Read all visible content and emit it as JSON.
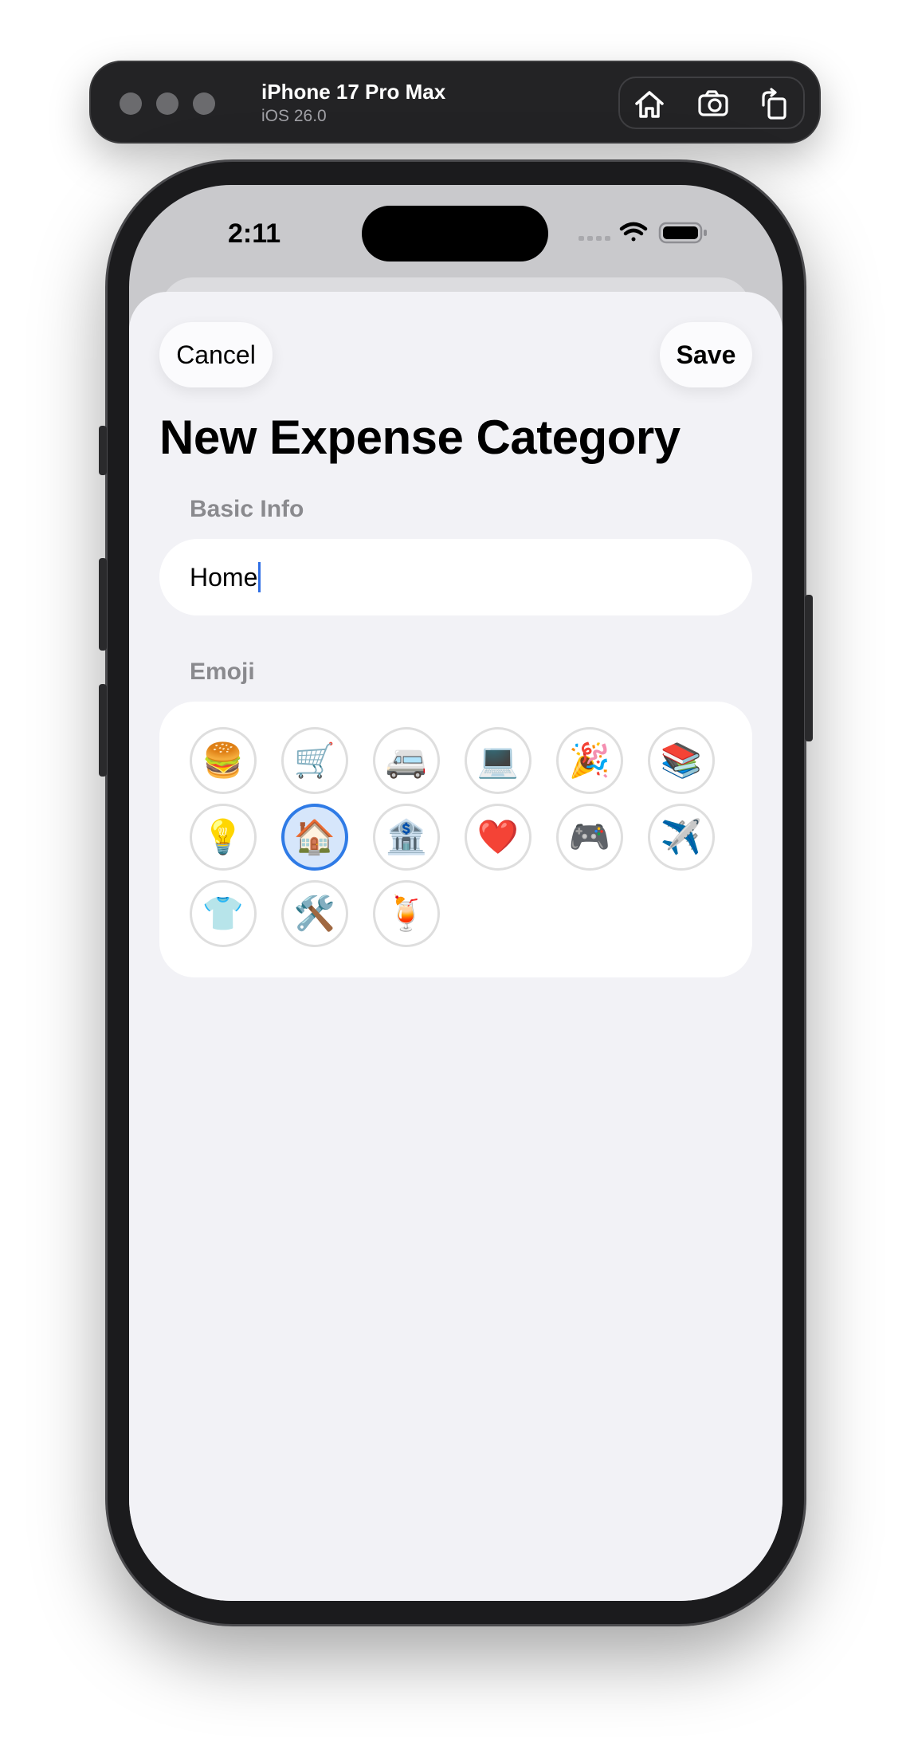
{
  "simulator": {
    "device_name": "iPhone 17 Pro Max",
    "os_version": "iOS 26.0",
    "icons": [
      "home-icon",
      "screenshot-icon",
      "rotate-icon"
    ]
  },
  "status_bar": {
    "time": "2:11",
    "icons": [
      "signal-icon",
      "wifi-icon",
      "battery-icon"
    ]
  },
  "nav": {
    "cancel_label": "Cancel",
    "save_label": "Save"
  },
  "page_title": "New Expense Category",
  "basic_info": {
    "section_label": "Basic Info",
    "name_value": "Home"
  },
  "emoji_section": {
    "section_label": "Emoji",
    "selected_index": 7,
    "items": [
      {
        "emoji": "🍔",
        "name": "burger"
      },
      {
        "emoji": "🛒",
        "name": "shopping-cart"
      },
      {
        "emoji": "🚐",
        "name": "bus"
      },
      {
        "emoji": "💻",
        "name": "laptop"
      },
      {
        "emoji": "🎉",
        "name": "party-popper"
      },
      {
        "emoji": "📚",
        "name": "books"
      },
      {
        "emoji": "💡",
        "name": "light-bulb"
      },
      {
        "emoji": "🏠",
        "name": "house"
      },
      {
        "emoji": "🏦",
        "name": "bank"
      },
      {
        "emoji": "❤️",
        "name": "heart"
      },
      {
        "emoji": "🎮",
        "name": "game-controller"
      },
      {
        "emoji": "✈️",
        "name": "airplane"
      },
      {
        "emoji": "👕",
        "name": "shirt"
      },
      {
        "emoji": "🛠️",
        "name": "tools"
      },
      {
        "emoji": "🍹",
        "name": "tropical-drink"
      }
    ]
  },
  "colors": {
    "accent": "#2f7be6",
    "selected_fill": "#d6e6fb",
    "sheet_background": "#f2f2f6",
    "section_label": "#8a8a8e"
  }
}
